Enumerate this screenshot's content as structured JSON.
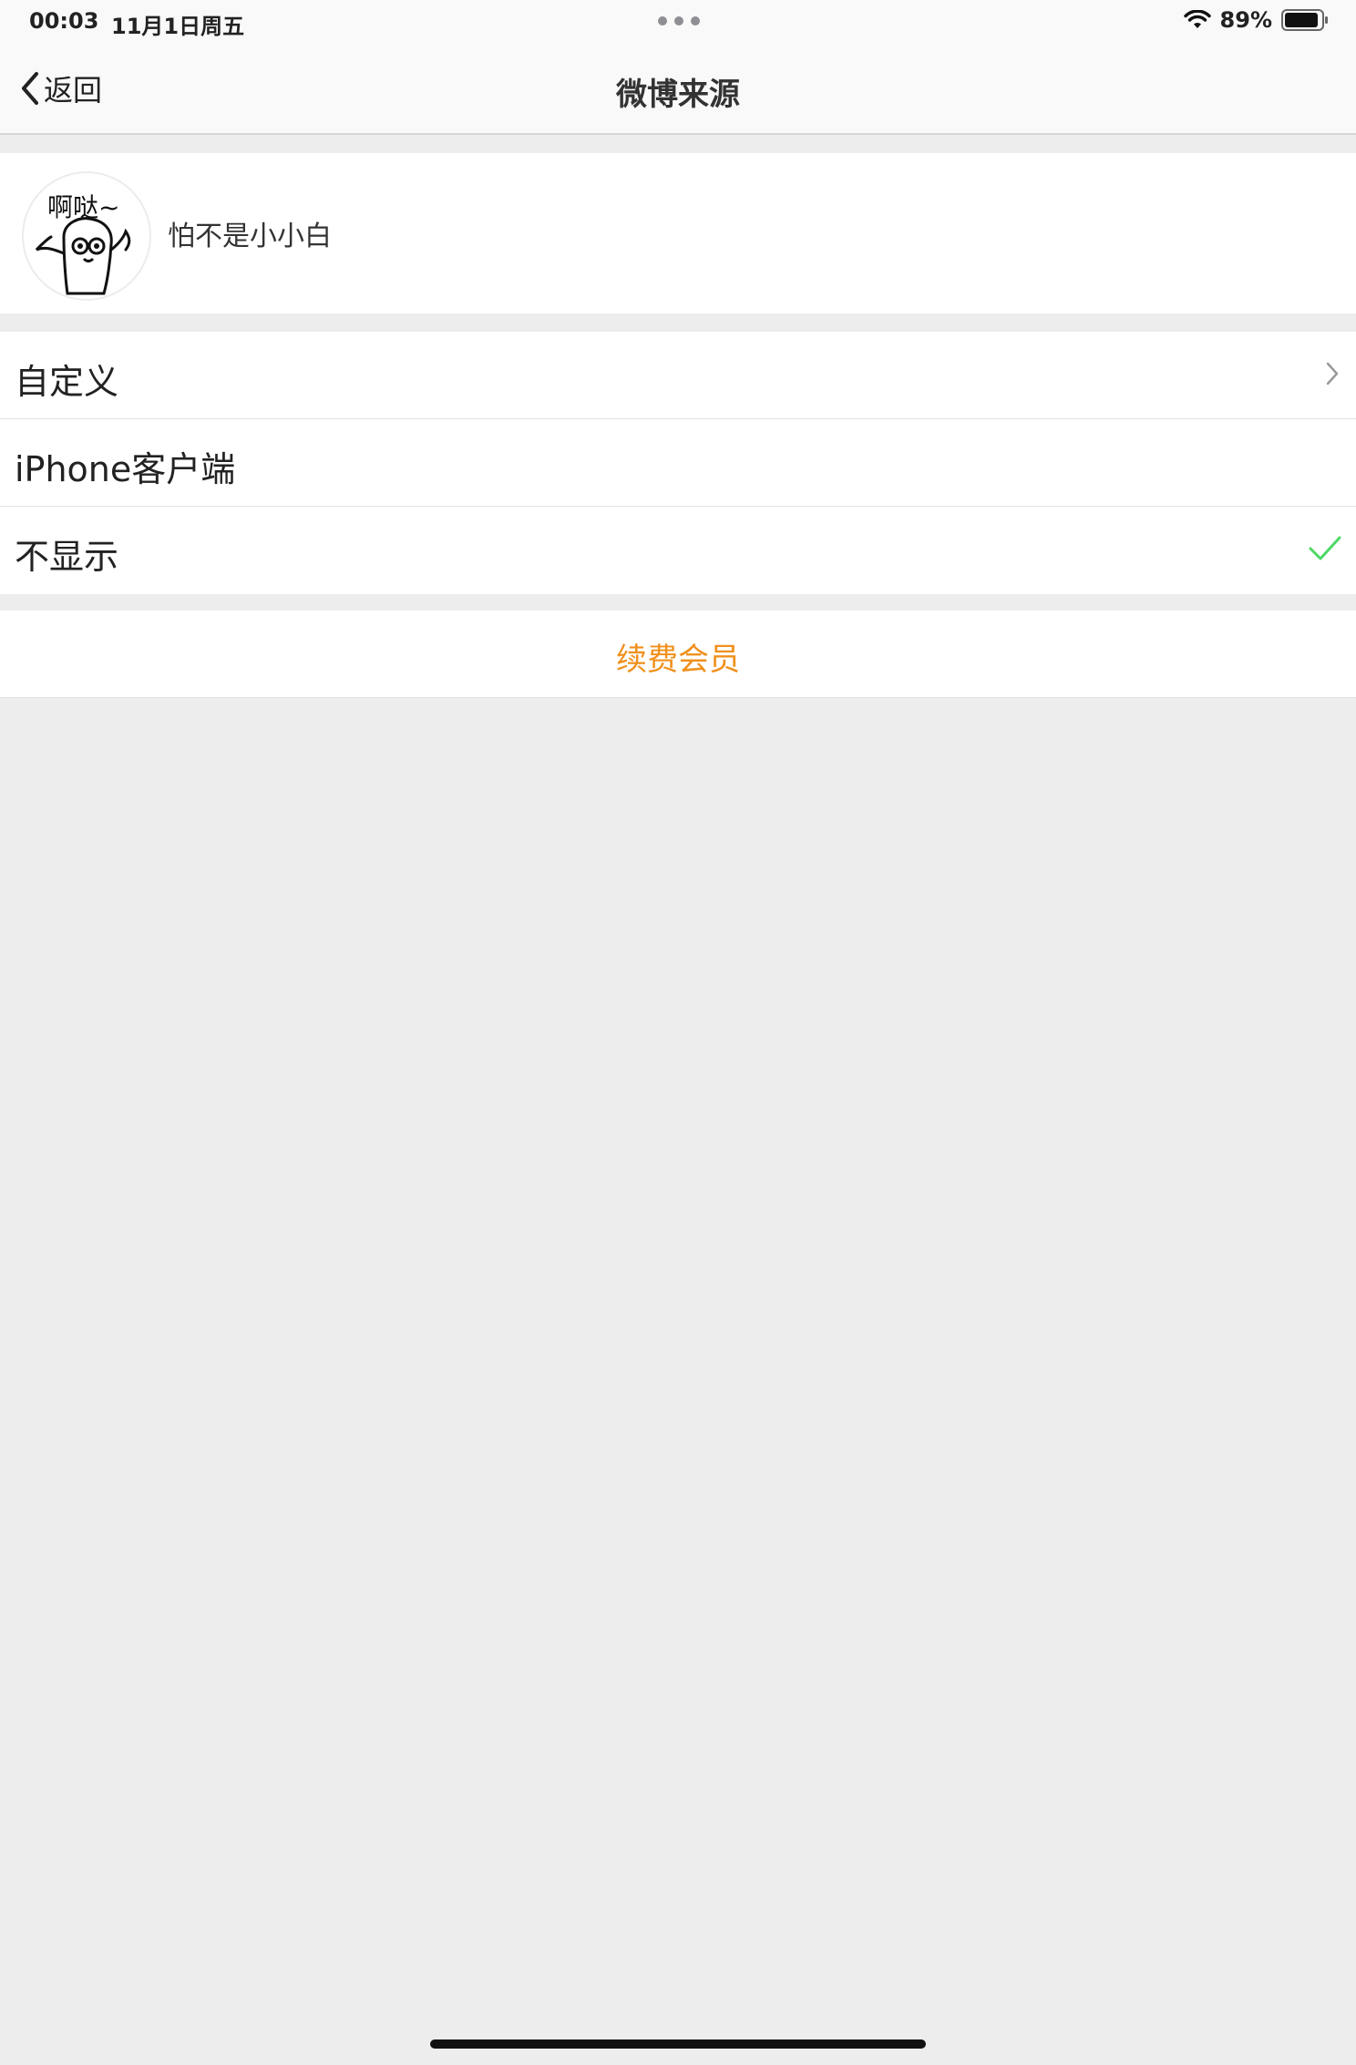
{
  "status_bar": {
    "time": "00:03",
    "date": "11月1日周五",
    "battery": "89%"
  },
  "nav": {
    "back_label": "返回",
    "title": "微博来源"
  },
  "profile": {
    "avatar_text": "啊哒~",
    "username": "怕不是小小白"
  },
  "options": [
    {
      "label": "自定义",
      "accessory": "chevron"
    },
    {
      "label": "iPhone客户端",
      "accessory": "none"
    },
    {
      "label": "不显示",
      "accessory": "checkmark"
    }
  ],
  "renew": {
    "label": "续费会员"
  },
  "colors": {
    "accent_orange": "#f0901c",
    "check_green": "#4cd964",
    "background": "#ededed"
  }
}
